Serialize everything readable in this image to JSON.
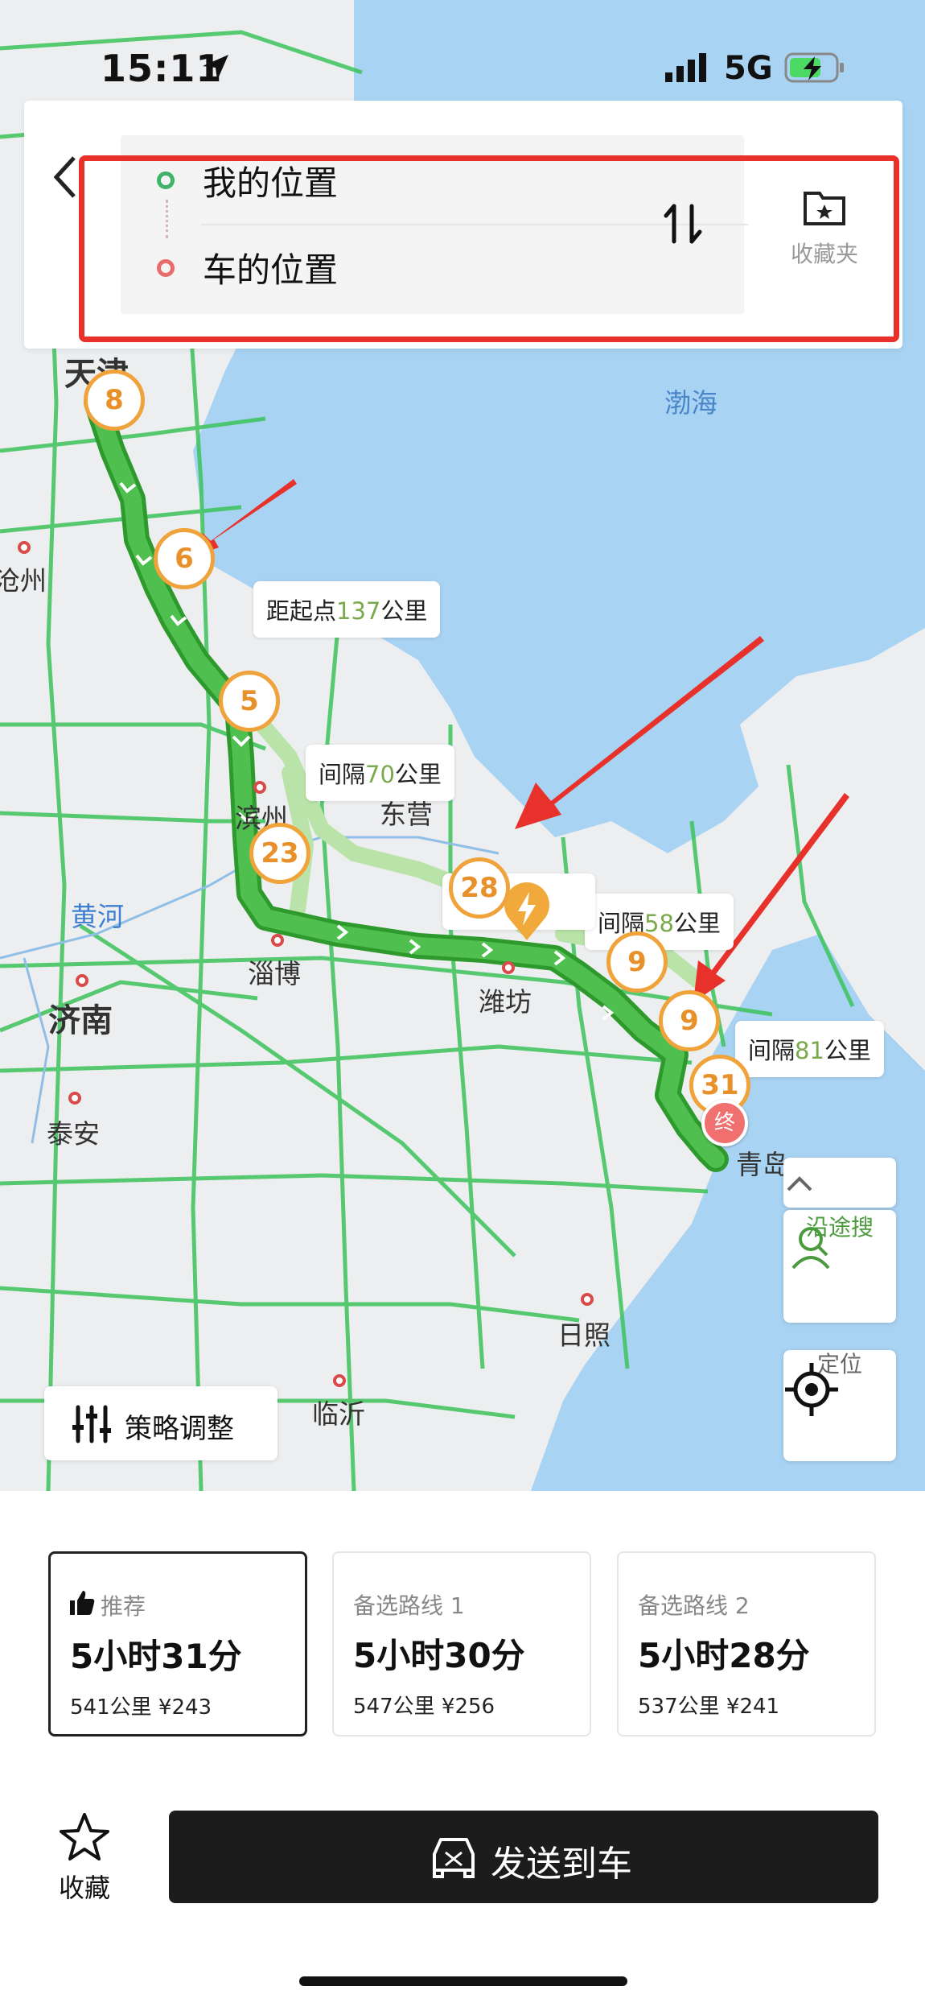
{
  "status_bar": {
    "time": "15:11",
    "network": "5G"
  },
  "search": {
    "origin": "我的位置",
    "destination": "车的位置",
    "favorites_label": "收藏夹"
  },
  "map": {
    "cities": [
      "天津",
      "沧州",
      "滨州",
      "东营",
      "淄博",
      "潍坊",
      "济南",
      "泰安",
      "青岛",
      "日照",
      "临沂"
    ],
    "water_labels": [
      "渤海",
      "黄河"
    ],
    "callouts": {
      "c1": {
        "prefix": "距起点",
        "value": "137",
        "unit": "公里"
      },
      "c2": {
        "prefix": "间隔",
        "value": "70",
        "unit": "公里"
      },
      "c3": {
        "prefix": "间隔",
        "value": "58",
        "unit": "公里"
      },
      "c4": {
        "prefix": "间隔",
        "value": "81",
        "unit": "公里"
      }
    },
    "badges": [
      "8",
      "6",
      "5",
      "23",
      "28",
      "9",
      "9",
      "31"
    ],
    "end_marker": "终",
    "strategy_label": "策略调整",
    "along_search_label": "沿途搜",
    "locate_label": "定位"
  },
  "routes": [
    {
      "tag": "推荐",
      "duration": "5小时31分",
      "distance": "541公里",
      "cost": "¥243"
    },
    {
      "tag": "备选路线 1",
      "duration": "5小时30分",
      "distance": "547公里",
      "cost": "¥256"
    },
    {
      "tag": "备选路线 2",
      "duration": "5小时28分",
      "distance": "537公里",
      "cost": "¥241"
    }
  ],
  "bottom": {
    "favorite_label": "收藏",
    "send_label": "发送到车"
  },
  "colors": {
    "route": "#3fae3f",
    "alt_route": "#b9e3a8",
    "highway": "#3cc35a",
    "sea": "#a9d3f3",
    "annotation": "#e8312a",
    "badge": "#f0a23b"
  }
}
